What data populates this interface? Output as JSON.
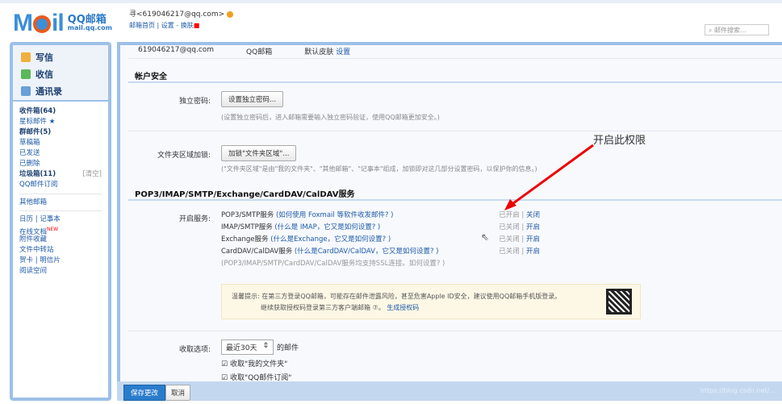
{
  "header": {
    "logo_text": "Mail",
    "logo_brand": "QQ邮箱",
    "logo_domain": "mail.qq.com",
    "user": "寻<619046217@qq.com>",
    "nav": [
      "邮箱首页",
      "设置",
      "换肤"
    ],
    "search_placeholder": "邮件搜索..."
  },
  "sidebar": {
    "actions": [
      "写信",
      "收信",
      "通讯录"
    ],
    "folders": [
      {
        "label": "收件箱(64)",
        "bold": true
      },
      {
        "label": "星标邮件 ★"
      },
      {
        "label": "群邮件(5)",
        "bold": true
      },
      {
        "label": "草稿箱"
      },
      {
        "label": "已发送"
      },
      {
        "label": "已删除"
      },
      {
        "label": "垃圾箱(11)",
        "bold": true,
        "extra": "[清空]"
      },
      {
        "label": "QQ邮件订阅"
      }
    ],
    "other": "其他邮箱",
    "tools": [
      "日历 | 记事本",
      "在线文档",
      "附件收藏",
      "文件中转站",
      "贺卡 | 明信片",
      "阅读空间"
    ],
    "new_badge": "NEW"
  },
  "main": {
    "info": {
      "email": "619046217@qq.com",
      "brand": "QQ邮箱",
      "skin": "默认皮肤",
      "settings": "设置"
    },
    "account_title": "帐户安全",
    "pwd_label": "独立密码:",
    "pwd_button": "设置独立密码...",
    "pwd_hint": "(设置独立密码后，进入邮箱需要输入独立密码验证，使用QQ邮箱更加安全。)",
    "folder_label": "文件夹区域加锁:",
    "folder_button": "加锁\"文件夹区域\"...",
    "folder_hint": "(\"文件夹区域\"是由\"我的文件夹\"、\"其他邮箱\"、\"记事本\"组成，加锁即对这几部分设置密码，以保护你的信息。)",
    "services_title": "POP3/IMAP/SMTP/Exchange/CardDAV/CalDAV服务",
    "services_label": "开启服务:",
    "services": [
      {
        "name": "POP3/SMTP服务",
        "help": "(如何使用 Foxmail 等软件收发邮件? )",
        "status": "已开启",
        "action": "关闭"
      },
      {
        "name": "IMAP/SMTP服务",
        "help": "(什么是 IMAP，它又是如何设置? )",
        "status": "已关闭",
        "action": "开启"
      },
      {
        "name": "Exchange服务",
        "help": "(什么是Exchange，它又是如何设置? )",
        "status": "已关闭",
        "action": "开启"
      },
      {
        "name": "CardDAV/CalDAV服务",
        "help": "(什么是CardDAV/CalDAV，它又是如何设置? )",
        "status": "已关闭",
        "action": "开启"
      }
    ],
    "ssl_note": "(POP3/IMAP/SMTP/CardDAV/CalDAV服务均支持SSL连接。如何设置? )",
    "tip_line1": "温馨提示: 在第三方登录QQ邮箱，可能存在邮件泄露风险，甚至危害Apple ID安全，建议使用QQ邮箱手机版登录。",
    "tip_line2": "继续获取授权码登录第三方客户端邮箱 ⑦。",
    "tip_link": "生成授权码",
    "fetch_label": "收取选项:",
    "fetch_select": "最近30天",
    "fetch_suffix": "的邮件",
    "check1": "收取\"我的文件夹\"",
    "check2": "收取\"QQ邮件订阅\""
  },
  "bottom": {
    "save": "保存更改",
    "cancel": "取消",
    "watermark": "https://blog.csdn.net/..."
  },
  "annotation": "开启此权限"
}
